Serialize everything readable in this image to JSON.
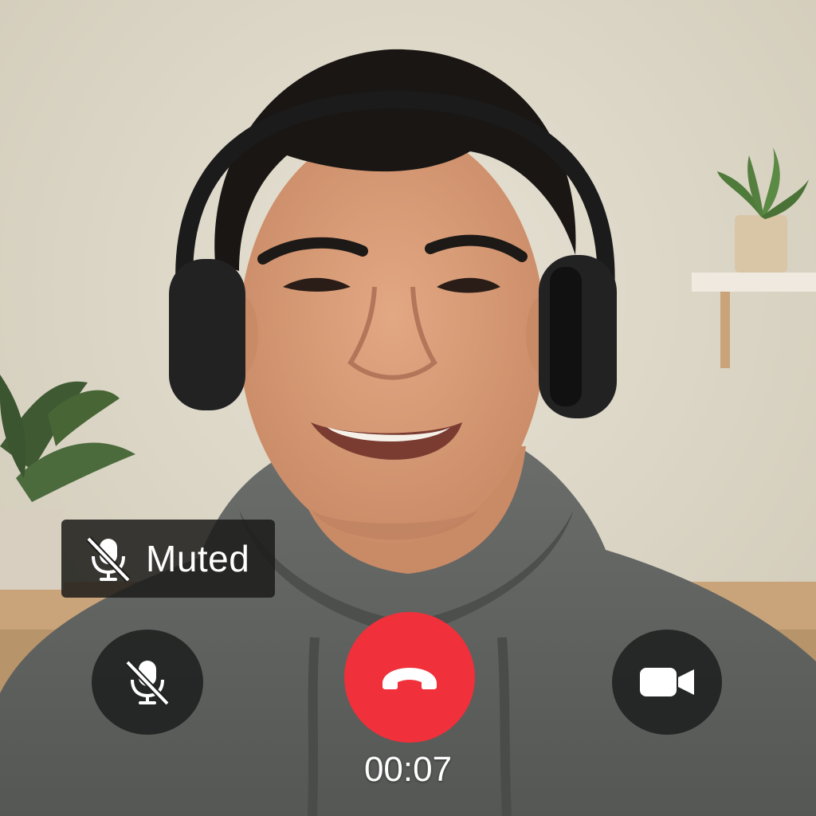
{
  "call": {
    "status_label": "Muted",
    "timer": "00:07"
  },
  "controls": {
    "mute": {
      "icon": "microphone-off-icon",
      "state": "muted"
    },
    "end_call": {
      "icon": "phone-hangup-icon",
      "color": "#f0303a"
    },
    "video": {
      "icon": "video-camera-icon"
    }
  },
  "colors": {
    "end_call": "#f0303a",
    "control_bg": "#1e201f",
    "chip_bg": "#1c1c1a",
    "text": "#ffffff"
  }
}
